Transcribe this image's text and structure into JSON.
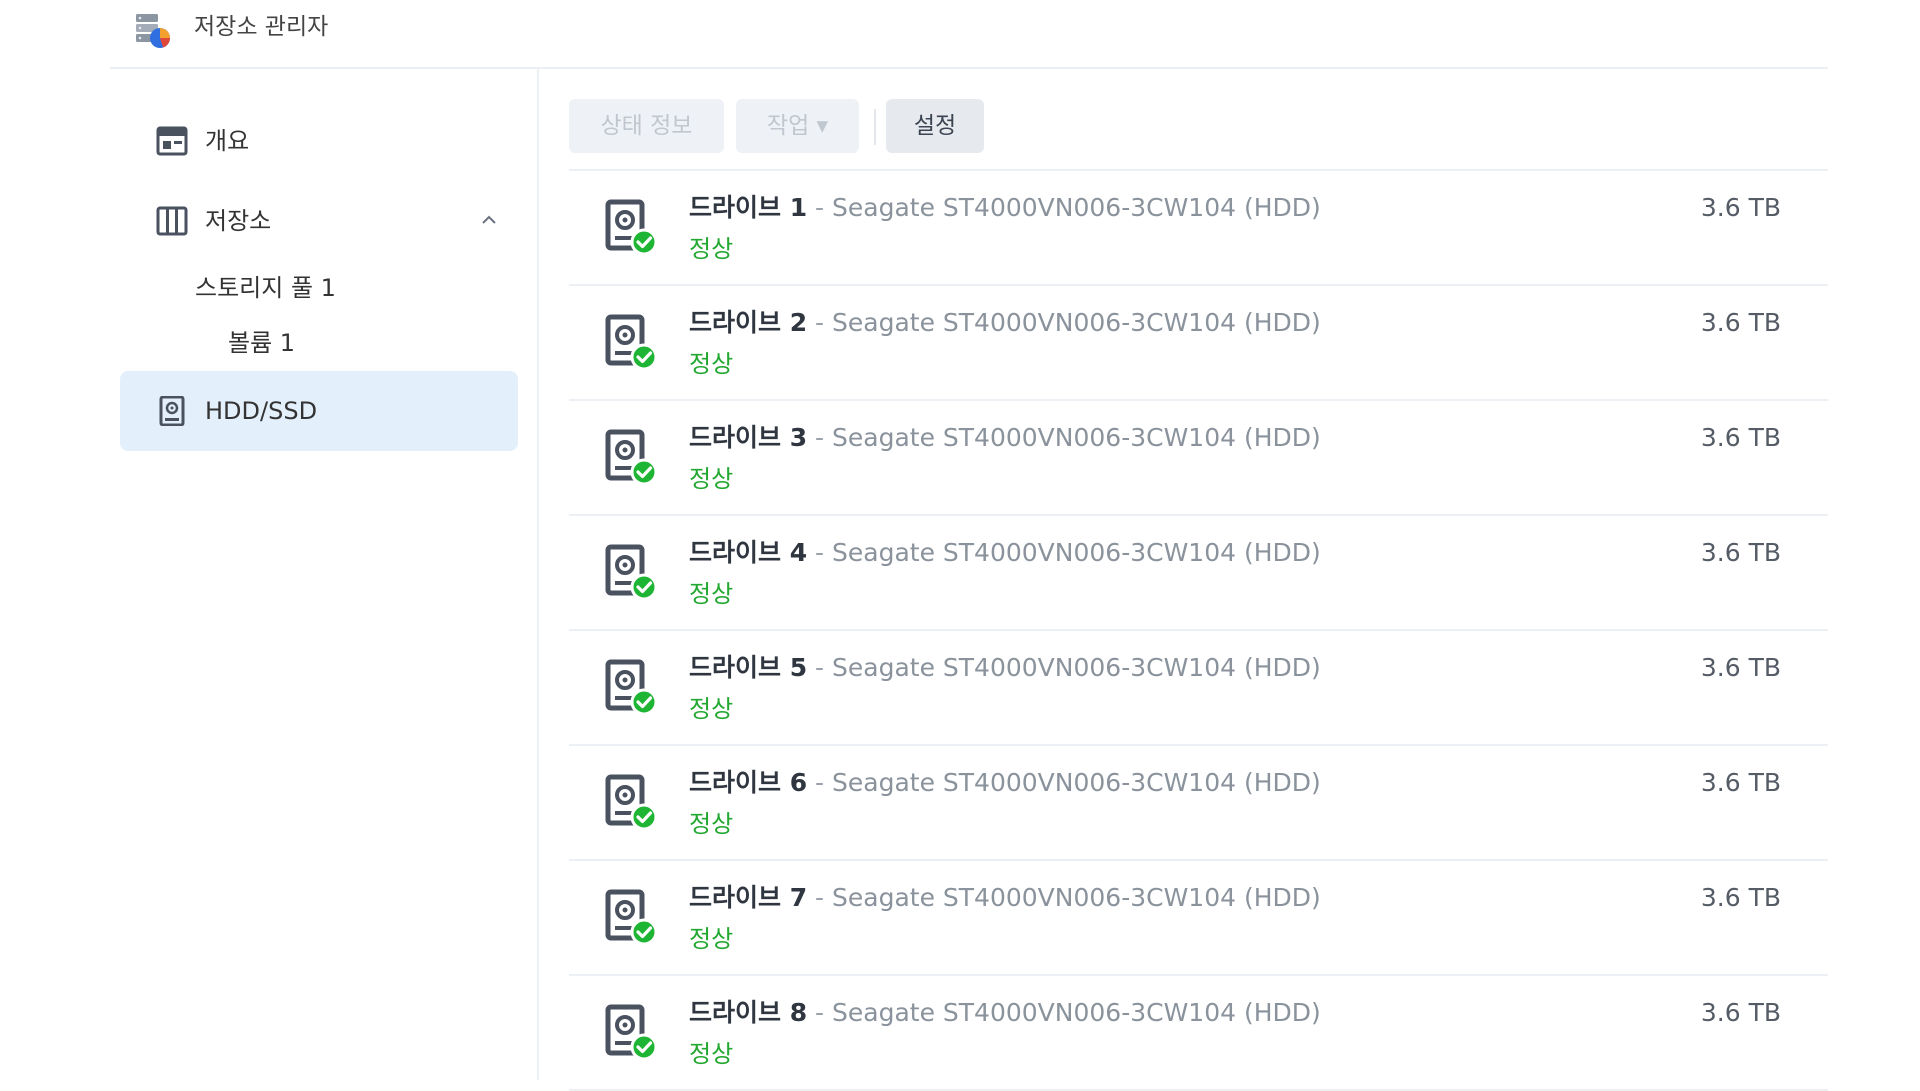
{
  "app": {
    "title": "저장소 관리자"
  },
  "sidebar": {
    "items": [
      {
        "label": "개요",
        "icon": "overview-icon"
      },
      {
        "label": "저장소",
        "icon": "storage-icon",
        "expanded": true,
        "children": [
          {
            "label": "스토리지 풀 1"
          },
          {
            "label": "볼륨 1"
          }
        ]
      },
      {
        "label": "HDD/SSD",
        "icon": "hdd-icon",
        "active": true
      }
    ]
  },
  "toolbar": {
    "status_info": "상태 정보",
    "action": "작업 ▾",
    "settings": "설정"
  },
  "drive_sep": " - ",
  "drives": [
    {
      "name": "드라이브 1",
      "model": "Seagate ST4000VN006-3CW104 (HDD)",
      "status": "정상",
      "size": "3.6 TB"
    },
    {
      "name": "드라이브 2",
      "model": "Seagate ST4000VN006-3CW104 (HDD)",
      "status": "정상",
      "size": "3.6 TB"
    },
    {
      "name": "드라이브 3",
      "model": "Seagate ST4000VN006-3CW104 (HDD)",
      "status": "정상",
      "size": "3.6 TB"
    },
    {
      "name": "드라이브 4",
      "model": "Seagate ST4000VN006-3CW104 (HDD)",
      "status": "정상",
      "size": "3.6 TB"
    },
    {
      "name": "드라이브 5",
      "model": "Seagate ST4000VN006-3CW104 (HDD)",
      "status": "정상",
      "size": "3.6 TB"
    },
    {
      "name": "드라이브 6",
      "model": "Seagate ST4000VN006-3CW104 (HDD)",
      "status": "정상",
      "size": "3.6 TB"
    },
    {
      "name": "드라이브 7",
      "model": "Seagate ST4000VN006-3CW104 (HDD)",
      "status": "정상",
      "size": "3.6 TB"
    },
    {
      "name": "드라이브 8",
      "model": "Seagate ST4000VN006-3CW104 (HDD)",
      "status": "정상",
      "size": "3.6 TB"
    }
  ],
  "colors": {
    "active_nav_bg": "#e4effc",
    "status_ok": "#22a830",
    "status_badge": "#1fb534"
  }
}
